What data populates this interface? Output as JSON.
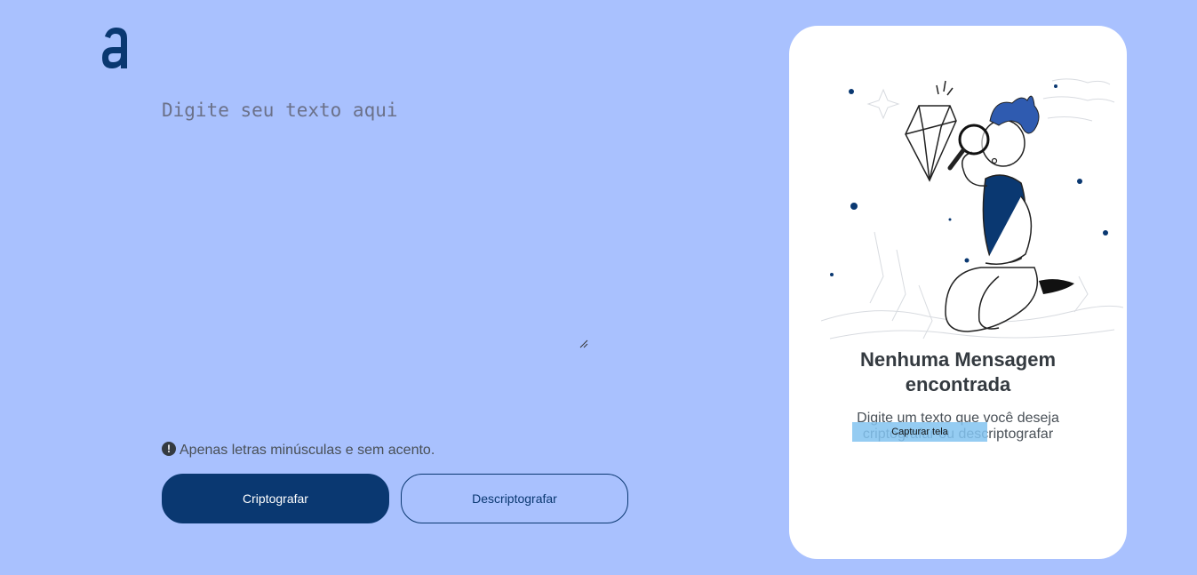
{
  "logo": {
    "icon": "alura-logo-icon"
  },
  "editor": {
    "placeholder": "Digite seu texto aqui",
    "value": ""
  },
  "hint": {
    "icon": "exclamation-circle-icon",
    "text": "Apenas letras minúsculas e sem acento."
  },
  "buttons": {
    "encrypt_label": "Criptografar",
    "decrypt_label": "Descriptografar"
  },
  "output": {
    "illustration": "person-with-magnifying-glass-illustration",
    "title": "Nenhuma Mensagem encontrada",
    "text": "Digite um texto que você deseja criptografar ou descriptografar"
  },
  "overlay": {
    "label": "Capturar tela"
  },
  "colors": {
    "background": "#a9c1fe",
    "primary": "#0a3871",
    "card": "#ffffff"
  }
}
